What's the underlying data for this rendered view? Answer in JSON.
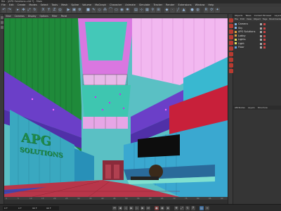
{
  "app": {
    "title": "file - [APG Solutions.c4d *] - Main"
  },
  "menu": {
    "items": [
      "File",
      "Edit",
      "Create",
      "Modes",
      "Select",
      "Tools",
      "Mesh",
      "Spline",
      "Volume",
      "MoGraph",
      "Character",
      "Animate",
      "Simulate",
      "Tracker",
      "Render",
      "Extensions",
      "Window",
      "Help"
    ]
  },
  "viewport_menu": {
    "items": [
      "View",
      "Cameras",
      "Display",
      "Options",
      "Filter",
      "Panel"
    ]
  },
  "scene": {
    "sign_line1": "APG",
    "sign_line2": "SOLUTIONS"
  },
  "object_manager": {
    "tabs": [
      "Objects",
      "Takes",
      "Content Browser",
      "Layers"
    ],
    "menu": [
      "File",
      "Edit",
      "View",
      "Object",
      "Tags",
      "Bookmarks"
    ],
    "objects": [
      {
        "name": "Camera",
        "icon": "camera-icon",
        "color": "#7fb0e0"
      },
      {
        "name": "Sky",
        "icon": "sky-icon",
        "color": "#7fb0e0"
      },
      {
        "name": "APG Solutions",
        "icon": "null-icon",
        "color": "#e0a040"
      },
      {
        "name": "Lobby",
        "icon": "null-icon",
        "color": "#e0a040"
      },
      {
        "name": "Lights",
        "icon": "light-icon",
        "color": "#e0e060"
      },
      {
        "name": "Light",
        "icon": "light-icon",
        "color": "#e0e060"
      },
      {
        "name": "Floor",
        "icon": "polygon-icon",
        "color": "#60a0e0"
      }
    ]
  },
  "attribute_manager": {
    "tabs": [
      "Attributes",
      "Layers",
      "Structure"
    ]
  },
  "timeline": {
    "ticks": [
      "0",
      "5",
      "10",
      "15",
      "20",
      "25",
      "30",
      "35",
      "40",
      "45",
      "50",
      "55",
      "60",
      "65",
      "70",
      "75",
      "80",
      "85",
      "90"
    ]
  },
  "status": {
    "current_frame": "0 F",
    "start_frame": "0 F",
    "end_frame": "90 F",
    "max_frame": "90 F"
  }
}
